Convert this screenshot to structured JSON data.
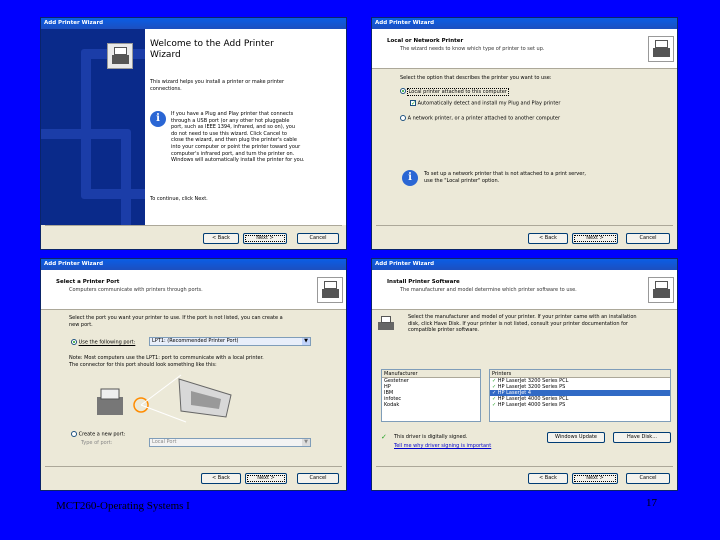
{
  "footer": {
    "course": "MCT260-Operating Systems I",
    "page": "17"
  },
  "w1": {
    "title": "Add Printer Wizard",
    "heading_line1": "Welcome to the Add Printer",
    "heading_line2": "Wizard",
    "intro": "This wizard helps you install a printer or make printer connections.",
    "info_lines": [
      "If you have a Plug and Play printer that connects",
      "through a USB port (or any other hot pluggable",
      "port, such as IEEE 1394, infrared, and so on), you",
      "do not need to use this wizard. Click Cancel to",
      "close the wizard, and then plug the printer's cable",
      "into your computer or point the printer toward your",
      "computer's infrared port, and turn the printer on.",
      "Windows will automatically install the printer for you."
    ],
    "continue": "To continue, click Next.",
    "back": "< Back",
    "next": "Next >",
    "cancel": "Cancel"
  },
  "w2": {
    "title": "Add Printer Wizard",
    "heading": "Local or Network Printer",
    "subheading": "The wizard needs to know which type of printer to set up.",
    "prompt": "Select the option that describes the printer you want to use:",
    "opt_local": "Local printer attached to this computer",
    "opt_auto": "Automatically detect and install my Plug and Play printer",
    "opt_network": "A network printer, or a printer attached to another computer",
    "info_lines": [
      "To set up a network printer that is not attached to a print server,",
      "use the \"Local printer\" option."
    ],
    "back": "< Back",
    "next": "Next >",
    "cancel": "Cancel"
  },
  "w3": {
    "title": "Add Printer Wizard",
    "heading": "Select a Printer Port",
    "subheading": "Computers communicate with printers through ports.",
    "prompt_lines": [
      "Select the port you want your printer to use. If the port is not listed, you can create a",
      "new port."
    ],
    "opt_use": "Use the following port:",
    "port_value": "LPT1: (Recommended Printer Port)",
    "note_lines": [
      "Note: Most computers use the LPT1: port to communicate with a local printer.",
      "The connector for this port should look something like this:"
    ],
    "opt_create": "Create a new port:",
    "type_label": "Type of port:",
    "type_value": "Local Port",
    "back": "< Back",
    "next": "Next >",
    "cancel": "Cancel"
  },
  "w4": {
    "title": "Add Printer Wizard",
    "heading": "Install Printer Software",
    "subheading": "The manufacturer and model determine which printer software to use.",
    "prompt_lines": [
      "Select the manufacturer and model of your printer. If your printer came with an installation",
      "disk, click Have Disk. If your printer is not listed, consult your printer documentation for",
      "compatible printer software."
    ],
    "manufacturer_header": "Manufacturer",
    "manufacturers": [
      "Gestetner",
      "HP",
      "IBM",
      "infotec",
      "Kodak"
    ],
    "printers_header": "Printers",
    "printers": [
      "HP LaserJet 3200 Series PCL",
      "HP LaserJet 3200 Series PS",
      "HP LaserJet 4",
      "HP LaserJet 4000 Series PCL",
      "HP LaserJet 4000 Series PS"
    ],
    "signed": "This driver is digitally signed.",
    "why": "Tell me why driver signing is important",
    "windows_update": "Windows Update",
    "have_disk": "Have Disk...",
    "back": "< Back",
    "next": "Next >",
    "cancel": "Cancel"
  }
}
